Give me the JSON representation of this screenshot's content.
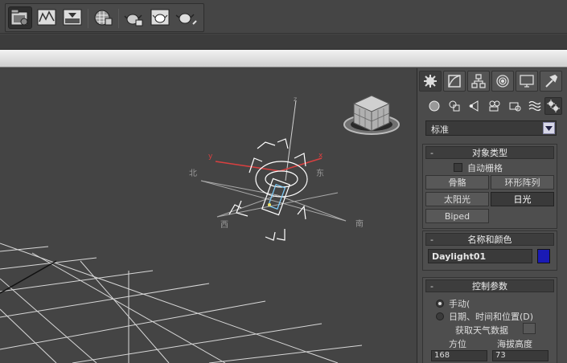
{
  "icons": {
    "toolbar": [
      "render-setup-icon",
      "rendered-frame-window-icon",
      "render-production-icon",
      "material-editor-icon",
      "render-teapot-icon",
      "render-iterative-icon",
      "active-shade-icon"
    ],
    "panel_tabs": [
      "create-tab-icon",
      "modify-tab-icon",
      "hierarchy-tab-icon",
      "motion-tab-icon",
      "display-tab-icon",
      "utilities-tab-icon"
    ],
    "create_categories": [
      "geometry-icon",
      "shapes-icon",
      "lights-icon",
      "cameras-icon",
      "helpers-icon",
      "space-warps-icon",
      "systems-icon"
    ]
  },
  "viewport": {
    "labels": {
      "north": "北",
      "east": "东",
      "west": "西",
      "south": "南",
      "z_axis": "z",
      "x_axis": "x",
      "y_axis": "y"
    },
    "colors": {
      "x_axis": "#d94040",
      "y_axis": "#d94040",
      "z_axis": "#d0d0d0",
      "grid": "#d8d8d8",
      "gizmo": "#ffffff"
    }
  },
  "panel": {
    "category_dropdown": "标准",
    "object_type": {
      "title": "对象类型",
      "auto_grid_label": "自动栅格",
      "buttons": [
        "骨骼",
        "环形阵列",
        "太阳光",
        "日光",
        "Biped"
      ],
      "active_button": "日光"
    },
    "name_and_color": {
      "title": "名称和颜色",
      "name_value": "Daylight01",
      "color": "#1a1ab5"
    },
    "control_params": {
      "title": "控制参数",
      "manual_label": "手动(",
      "date_label": "日期、时间和位置(D)",
      "weather_label": "获取天气数据",
      "azimuth_label": "方位",
      "altitude_label": "海拔高度",
      "azimuth_value": "168",
      "altitude_value": "73"
    }
  }
}
